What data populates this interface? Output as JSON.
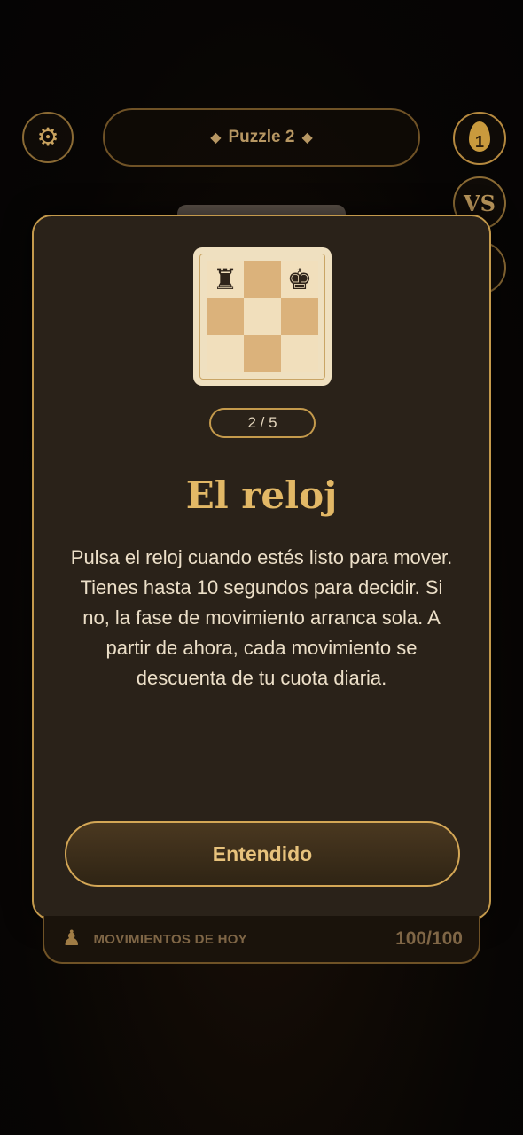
{
  "header": {
    "title_left_diamond": "◆",
    "title": "Puzzle 2",
    "title_right_diamond": "◆",
    "token_count": "1",
    "vs_label": "VS"
  },
  "modal": {
    "step": "2 / 5",
    "title": "El reloj",
    "body": "Pulsa el reloj cuando estés listo para mover. Tienes hasta 10 segundos para decidir. Si no, la fase de movimiento arranca sola. A partir de ahora, cada movimiento se descuenta de tu cuota diaria.",
    "confirm_label": "Entendido",
    "board": [
      [
        "♜",
        "",
        "♚"
      ],
      [
        "",
        "",
        ""
      ],
      [
        "",
        "",
        ""
      ]
    ]
  },
  "moves": {
    "label": "MOVIMIENTOS DE HOY",
    "value": "100/100"
  },
  "colors": {
    "accent_gold": "#c49a4c",
    "title_gold": "#e2b866",
    "modal_bg": "#2a2219"
  },
  "icons": {
    "settings": "gear-icon",
    "token": "flame-token-icon",
    "moves": "pawn-icon"
  }
}
